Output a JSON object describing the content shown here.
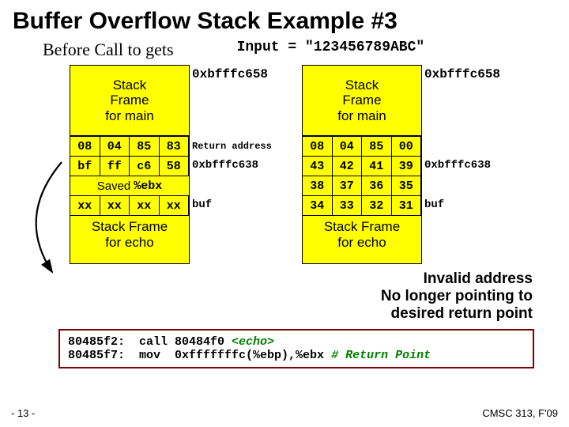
{
  "title": "Buffer Overflow Stack Example #3",
  "before_label": "Before Call to gets",
  "input_label": "Input = \"123456789ABC\"",
  "addr_top": "0xbfffc658",
  "main_frame_text": "Stack\nFrame\nfor main",
  "before": {
    "rows": [
      {
        "cells": [
          "08",
          "04",
          "85",
          "83"
        ],
        "note": "Return address",
        "note_small": true
      },
      {
        "cells": [
          "bf",
          "ff",
          "c6",
          "58"
        ],
        "note": "0xbfffc638"
      }
    ],
    "saved": "Saved",
    "saved_reg": "%ebx",
    "buf_row": {
      "cells": [
        "xx",
        "xx",
        "xx",
        "xx"
      ],
      "note": "buf"
    }
  },
  "after": {
    "rows": [
      {
        "cells": [
          "08",
          "04",
          "85",
          "00"
        ],
        "note": ""
      },
      {
        "cells": [
          "43",
          "42",
          "41",
          "39"
        ],
        "note": "0xbfffc638"
      },
      {
        "cells": [
          "38",
          "37",
          "36",
          "35"
        ],
        "note": ""
      },
      {
        "cells": [
          "34",
          "33",
          "32",
          "31"
        ],
        "note": "buf"
      }
    ]
  },
  "echo_frame_text": "Stack Frame\nfor echo",
  "invalid": "Invalid address\nNo longer pointing to\ndesired return point",
  "code": {
    "l1a": "80485f2:  call 80484f0 ",
    "l1b": "<echo>",
    "l2a": "80485f7:  mov  0xfffffffc(%ebp),%ebx ",
    "l2b": "# Return Point"
  },
  "page": "- 13 -",
  "course": "CMSC 313, F'09"
}
